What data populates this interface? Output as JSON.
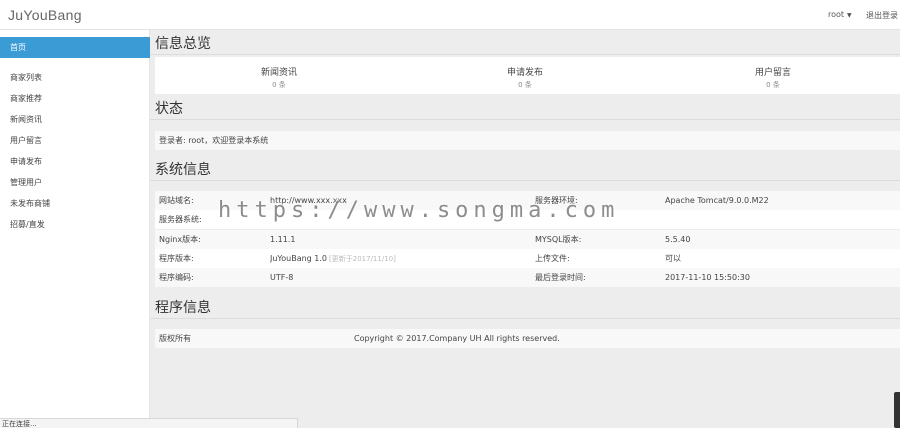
{
  "header": {
    "brand": "JuYouBang",
    "user": "root",
    "logout": "退出登录"
  },
  "sidebar": {
    "items": [
      {
        "label": "首页",
        "active": true
      },
      {
        "label": "商家列表"
      },
      {
        "label": "商家推荐"
      },
      {
        "label": "新闻资讯"
      },
      {
        "label": "用户留言"
      },
      {
        "label": "申请发布"
      },
      {
        "label": "管理用户"
      },
      {
        "label": "未发布商铺"
      },
      {
        "label": "招募/直发"
      }
    ]
  },
  "overview": {
    "title": "信息总览",
    "stats": [
      {
        "label": "新闻资讯",
        "count": "0 条"
      },
      {
        "label": "申请发布",
        "count": "0 条"
      },
      {
        "label": "用户留言",
        "count": "0 条"
      }
    ]
  },
  "status": {
    "title": "状态",
    "message": "登录者: root，欢迎登录本系统"
  },
  "system": {
    "title": "系统信息",
    "rows": [
      {
        "l1": "网站域名:",
        "v1": "http://www.xxx.xxx",
        "l2": "服务器环境:",
        "v2": "Apache Tomcat/9.0.0.M22"
      },
      {
        "l1": "服务器系统:",
        "v1": "",
        "l2": "",
        "v2": ""
      },
      {
        "l1": "Nginx版本:",
        "v1": "1.11.1",
        "l2": "MYSQL版本:",
        "v2": "5.5.40"
      },
      {
        "l1": "程序版本:",
        "v1": "JuYouBang 1.0",
        "v1_extra": "[更新于2017/11/10]",
        "l2": "上传文件:",
        "v2": "可以"
      },
      {
        "l1": "程序编码:",
        "v1": "UTF-8",
        "l2": "最后登录时间:",
        "v2": "2017-11-10 15:50:30"
      }
    ]
  },
  "program": {
    "title": "程序信息",
    "label": "版权所有",
    "copyright": "Copyright © 2017.Company UH All rights reserved."
  },
  "browser_status": "正在连接...",
  "watermark": "https://www.songma.com",
  "colors": {
    "accent": "#3a9bd5"
  }
}
